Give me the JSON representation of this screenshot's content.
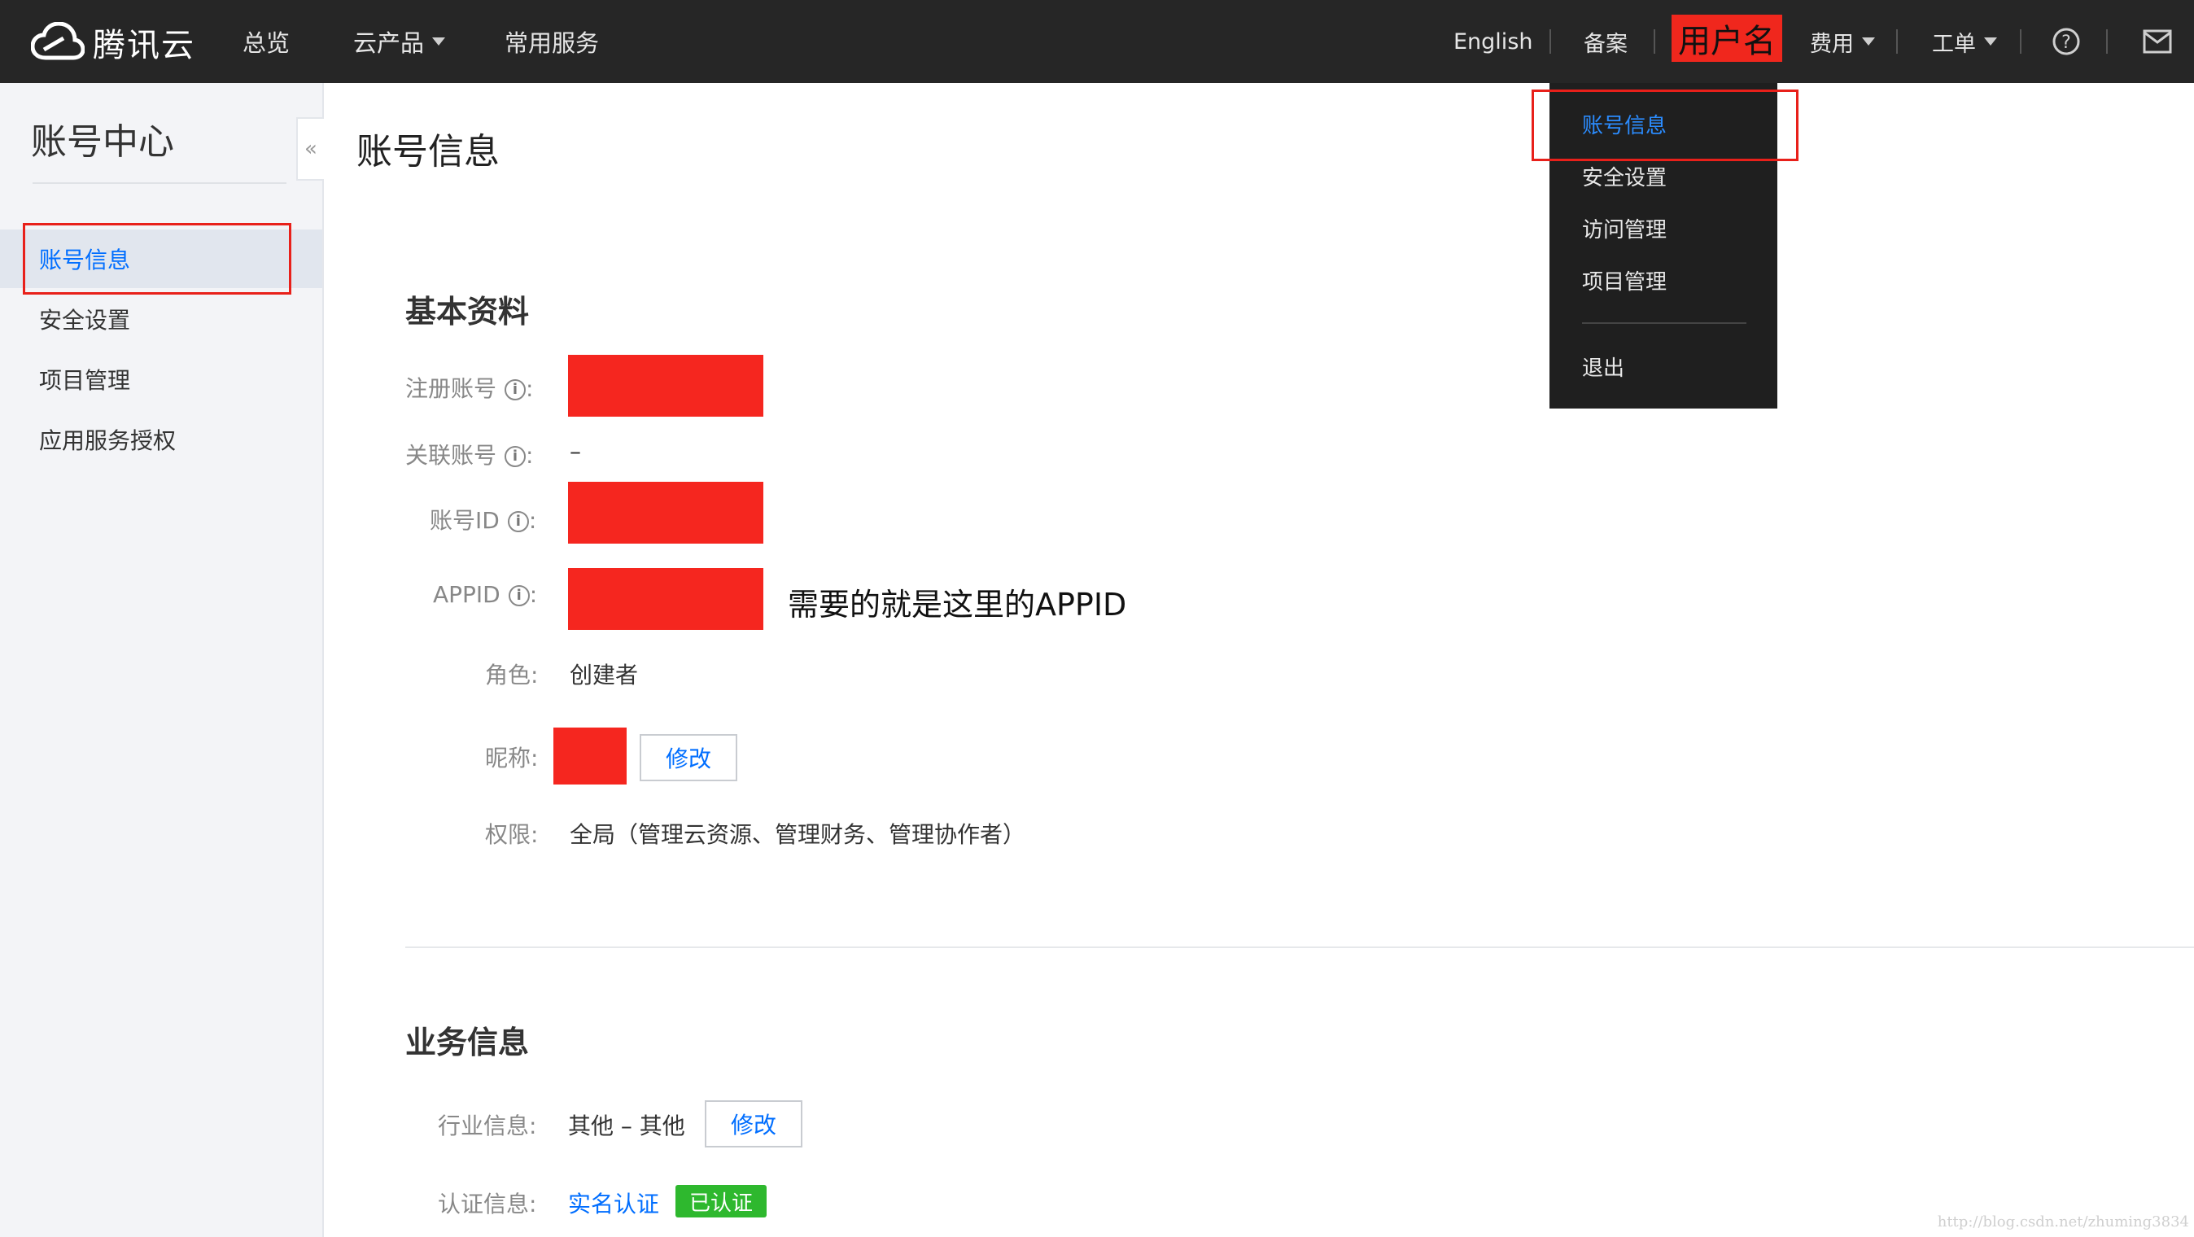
{
  "topbar": {
    "brand": "腾讯云",
    "nav": [
      "总览",
      "云产品",
      "常用服务"
    ],
    "right": {
      "english": "English",
      "beian": "备案",
      "username": "用户名",
      "fees": "费用",
      "tickets": "工单"
    }
  },
  "dropdown": {
    "items": [
      "账号信息",
      "安全设置",
      "访问管理",
      "项目管理"
    ],
    "logout": "退出"
  },
  "sidebar": {
    "title": "账号中心",
    "items": [
      "账号信息",
      "安全设置",
      "项目管理",
      "应用服务授权"
    ]
  },
  "main": {
    "title": "账号信息",
    "basic": {
      "section_title": "基本资料",
      "registered_account_label": "注册账号",
      "linked_account_label": "关联账号",
      "linked_account_value": "–",
      "account_id_label": "账号ID",
      "appid_label": "APPID",
      "appid_annotation": "需要的就是这里的APPID",
      "role_label": "角色:",
      "role_value": "创建者",
      "nickname_label": "昵称:",
      "edit_label": "修改",
      "permission_label": "权限:",
      "permission_value": "全局（管理云资源、管理财务、管理协作者）"
    },
    "business": {
      "section_title": "业务信息",
      "industry_label": "行业信息:",
      "industry_value": "其他 – 其他",
      "edit_label": "修改",
      "cert_label": "认证信息:",
      "cert_link": "实名认证",
      "cert_badge": "已认证"
    }
  },
  "watermark": "http://blog.csdn.net/zhuming3834",
  "colors": {
    "topbar": "#262626",
    "accent": "#006eff",
    "redaction": "#f5261f",
    "badge_green": "#2eb82e"
  },
  "icons": [
    "cloud-logo-icon",
    "chevron-down-icon",
    "help-icon",
    "mail-icon",
    "info-icon",
    "double-chevron-left-icon"
  ]
}
